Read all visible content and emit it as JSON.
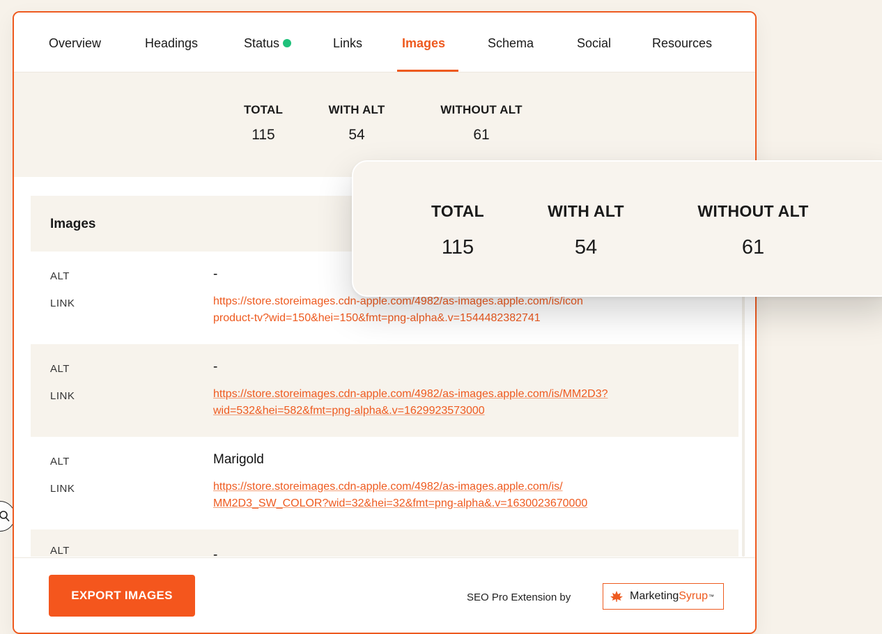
{
  "tabs": [
    {
      "label": "Overview"
    },
    {
      "label": "Headings"
    },
    {
      "label": "Status"
    },
    {
      "label": "Links"
    },
    {
      "label": "Images",
      "active": true
    },
    {
      "label": "Schema"
    },
    {
      "label": "Social"
    },
    {
      "label": "Resources"
    }
  ],
  "status_indicator_color": "#1fc17b",
  "accent_color": "#ee5a1f",
  "summary": {
    "total_label": "TOTAL",
    "total_value": "115",
    "with_alt_label": "WITH ALT",
    "with_alt_value": "54",
    "without_alt_label": "WITHOUT ALT",
    "without_alt_value": "61"
  },
  "images_section": {
    "title": "Images",
    "alt_label": "ALT",
    "link_label": "LINK",
    "rows": [
      {
        "alt": "-",
        "link_line1": "https://store.storeimages.cdn-apple.com/4982/as-images.apple.com/is/icon",
        "link_line2": "product-tv?wid=150&hei=150&fmt=png-alpha&.v=1544482382741"
      },
      {
        "alt": "-",
        "link_line1": "https://store.storeimages.cdn-apple.com/4982/as-images.apple.com/is/MM2D3?",
        "link_line2": "wid=532&hei=582&fmt=png-alpha&.v=1629923573000"
      },
      {
        "alt": "Marigold",
        "link_line1": "https://store.storeimages.cdn-apple.com/4982/as-images.apple.com/is/",
        "link_line2": "MM2D3_SW_COLOR?wid=32&hei=32&fmt=png-alpha&.v=1630023670000"
      },
      {
        "alt": "-",
        "link_line1": "",
        "link_line2": ""
      }
    ]
  },
  "footer": {
    "export_label": "EXPORT IMAGES",
    "byline": "SEO Pro Extension by",
    "brand_part1": "Marketing",
    "brand_part2": "Syrup",
    "brand_tm": "™"
  },
  "magnified_summary": {
    "total_label": "TOTAL",
    "total_value": "115",
    "with_alt_label": "WITH ALT",
    "with_alt_value": "54",
    "without_alt_label": "WITHOUT ALT",
    "without_alt_value": "61"
  },
  "edge_button_icon": "zoom-icon"
}
